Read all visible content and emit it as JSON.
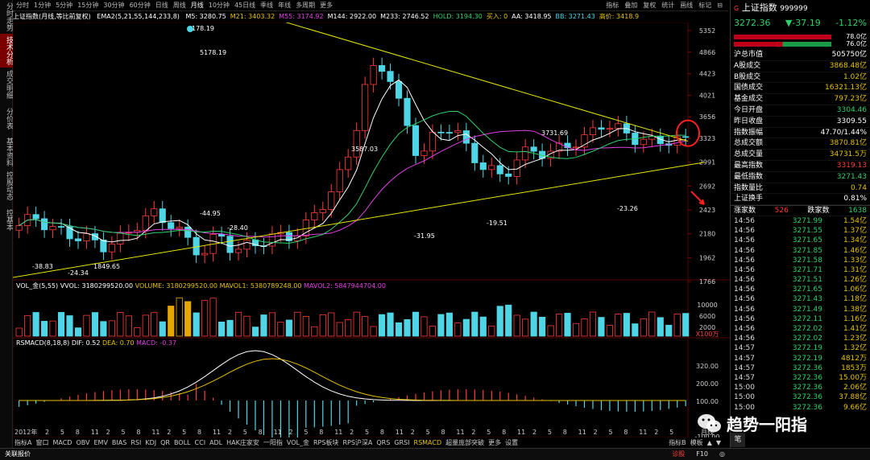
{
  "left_sidebar": [
    "分时走势",
    "技术分析",
    "成交明细",
    "分价表",
    "基本资料",
    "控股动态",
    "控基本"
  ],
  "left_sidebar_active": 1,
  "period_tabs": [
    "分时",
    "1分钟",
    "5分钟",
    "15分钟",
    "30分钟",
    "60分钟",
    "日线",
    "周线",
    "月线",
    "10分钟",
    "45日线",
    "季线",
    "年线",
    "多周期",
    "更多"
  ],
  "period_active": 8,
  "top_tools": [
    "指标",
    "叠加",
    "复权",
    "统计",
    "画线",
    "标记",
    "⊟"
  ],
  "header": {
    "title": "上证指数(月线,等比前复权)",
    "ema_label": "EMA2(5,21,55,144,233,8)",
    "items": [
      {
        "text": "M5: 3280.75",
        "color": "#ffffff"
      },
      {
        "text": "M21: 3403.32",
        "color": "#e6c200"
      },
      {
        "text": "M55: 3174.92",
        "color": "#e040e0"
      },
      {
        "text": "M144: 2922.00",
        "color": "#ffffff"
      },
      {
        "text": "M233: 2746.52",
        "color": "#ffffff"
      },
      {
        "text": "HOLD: 3194.30",
        "color": "#2ed16b"
      },
      {
        "text": "买入: 0",
        "color": "#e6c200"
      },
      {
        "text": "AA: 3418.95",
        "color": "#ffffff"
      },
      {
        "text": "BB: 3271.43",
        "color": "#4fd6e6"
      },
      {
        "text": "高价: 3418.9",
        "color": "#e6c200"
      }
    ]
  },
  "price_axis": [
    "5352",
    "4866",
    "4423",
    "4021",
    "3656",
    "3323",
    "2991",
    "2692",
    "2423",
    "2180",
    "1962",
    "1766"
  ],
  "price_annotations": [
    {
      "text": "5178.19",
      "color": "#ffffff"
    },
    {
      "text": "178.19",
      "color": "#ffffff"
    },
    {
      "text": "3587.03",
      "color": "#ffffff"
    },
    {
      "text": "3731.69",
      "color": "#ffffff"
    },
    {
      "text": "-44.95",
      "color": "#ffffff"
    },
    {
      "text": "-28.40",
      "color": "#ffffff"
    },
    {
      "text": "-31.95",
      "color": "#ffffff"
    },
    {
      "text": "-19.51",
      "color": "#ffffff"
    },
    {
      "text": "-23.26",
      "color": "#ffffff"
    },
    {
      "text": "-38.83",
      "color": "#ffffff"
    },
    {
      "text": "-24.34",
      "color": "#ffffff"
    },
    {
      "text": "1849.65",
      "color": "#ffffff"
    }
  ],
  "volume_panel": {
    "label": "VOL_金(5,55)",
    "vvol": "VVOL: 3180299520.00",
    "volume": "VOLUME: 3180299520.00",
    "mavol1": "MAVOL1: 5380789248.00",
    "mavol2": "MAVOL2: 5847944704.00",
    "axis": [
      "10000",
      "6000",
      "2000"
    ],
    "unit": "X100万"
  },
  "macd_panel": {
    "label": "RSMACD(8,18,8)",
    "dif": "DIF: 0.52",
    "dea": "DEA: 0.70",
    "macd": "MACD: -0.37",
    "axis": [
      "320.00",
      "200.00",
      "100.00",
      "0.00",
      "-100.00"
    ]
  },
  "x_axis": {
    "year": "2012年",
    "labels": [
      "2",
      "5",
      "8",
      "11",
      "2",
      "5",
      "8",
      "11",
      "2",
      "5",
      "8",
      "11",
      "2",
      "5",
      "8",
      "11",
      "2",
      "5",
      "8",
      "11",
      "2",
      "5",
      "8",
      "11",
      "2",
      "5",
      "8",
      "11",
      "2",
      "5",
      "8",
      "11",
      "2",
      "5",
      "8",
      "11",
      "2",
      "5",
      "8",
      "11",
      "2",
      "5"
    ],
    "right_label": "月线"
  },
  "bottom_tabs": [
    "指标A",
    "窗口",
    "MACD",
    "OBV",
    "EMV",
    "BIAS",
    "RSI",
    "KDJ",
    "QR",
    "BOLL",
    "CCI",
    "ADL",
    "HAK庄家安",
    "一阳指",
    "VOL_金",
    "RPS板块",
    "RPS沪深A",
    "QRS",
    "GRSI",
    "RSMACD",
    "超量庞部突破",
    "更多",
    "设置"
  ],
  "bottom_active": "RSMACD",
  "bottom_right": [
    "指标B",
    "模板",
    "▲",
    "▼"
  ],
  "status": {
    "left": "关联报价",
    "right_items": [
      "诊股",
      "F10",
      "◎"
    ]
  },
  "quote": {
    "name": "上证指数",
    "code": "999999",
    "price": "3272.36",
    "change": "▼-37.19",
    "pct": "-1.12%",
    "bar1": "78.0亿",
    "bar2": "76.0亿",
    "rows": [
      {
        "k": "沪总市值",
        "v": "505750亿",
        "c": "#ffffff"
      },
      {
        "k": "A股成交",
        "v": "3868.48亿",
        "c": "#e6c200"
      },
      {
        "k": "B股成交",
        "v": "1.02亿",
        "c": "#e6c200"
      },
      {
        "k": "国债成交",
        "v": "16321.13亿",
        "c": "#e6c200"
      },
      {
        "k": "基金成交",
        "v": "797.23亿",
        "c": "#e6c200"
      },
      {
        "k": "今日开盘",
        "v": "3304.46",
        "c": "#2ed16b"
      },
      {
        "k": "昨日收盘",
        "v": "3309.55",
        "c": "#ffffff"
      },
      {
        "k": "指数振幅",
        "v": "47.70/1.44%",
        "c": "#ffffff"
      },
      {
        "k": "总成交额",
        "v": "3870.81亿",
        "c": "#e6c200"
      },
      {
        "k": "总成交量",
        "v": "34731.5万",
        "c": "#e6c200"
      },
      {
        "k": "最高指数",
        "v": "3319.13",
        "c": "#ff3b3b"
      },
      {
        "k": "最低指数",
        "v": "3271.43",
        "c": "#2ed16b"
      },
      {
        "k": "指数量比",
        "v": "0.74",
        "c": "#e6c200"
      },
      {
        "k": "上证换手",
        "v": "0.81%",
        "c": "#ffffff"
      }
    ],
    "up_label": "涨家数",
    "up_count": "526",
    "down_label": "跌家数",
    "down_count": "1638",
    "ticks": [
      {
        "t": "14:56",
        "p": "3271.99",
        "c": "1.54亿"
      },
      {
        "t": "14:56",
        "p": "3271.55",
        "c": "1.37亿"
      },
      {
        "t": "14:56",
        "p": "3271.65",
        "c": "1.34亿"
      },
      {
        "t": "14:56",
        "p": "3271.85",
        "c": "1.46亿"
      },
      {
        "t": "14:56",
        "p": "3271.58",
        "c": "1.33亿"
      },
      {
        "t": "14:56",
        "p": "3271.71",
        "c": "1.31亿"
      },
      {
        "t": "14:56",
        "p": "3271.51",
        "c": "1.26亿"
      },
      {
        "t": "14:56",
        "p": "3271.65",
        "c": "1.06亿"
      },
      {
        "t": "14:56",
        "p": "3271.43",
        "c": "1.18亿"
      },
      {
        "t": "14:56",
        "p": "3271.49",
        "c": "1.38亿"
      },
      {
        "t": "14:56",
        "p": "3272.11",
        "c": "1.16亿"
      },
      {
        "t": "14:56",
        "p": "3272.02",
        "c": "1.41亿"
      },
      {
        "t": "14:56",
        "p": "3272.02",
        "c": "1.23亿"
      },
      {
        "t": "14:57",
        "p": "3272.19",
        "c": "1.32亿"
      },
      {
        "t": "14:57",
        "p": "3272.19",
        "c": "4812万"
      },
      {
        "t": "14:57",
        "p": "3272.36",
        "c": "1853万"
      },
      {
        "t": "14:57",
        "p": "3272.36",
        "c": "15.00万"
      },
      {
        "t": "15:00",
        "p": "3272.36",
        "c": "2.06亿"
      },
      {
        "t": "15:00",
        "p": "3272.36",
        "c": "37.88亿"
      },
      {
        "t": "15:00",
        "p": "3272.36",
        "c": "9.66亿"
      }
    ],
    "tab": "笔",
    "watermark": "趋势一阳指"
  },
  "chart_data": {
    "type": "candlestick",
    "period": "monthly",
    "title": "上证指数(月线,等比前复权)",
    "ylim": [
      1766,
      5352
    ],
    "highlights": {
      "high": 5178.19,
      "low": 1849.65
    },
    "trendline_upper": [
      [
        0,
        5178
      ],
      [
        40,
        3330
      ]
    ],
    "trendline_lower": [
      [
        0,
        2000
      ],
      [
        40,
        2990
      ]
    ],
    "closes": [
      2260,
      2350,
      2220,
      2180,
      2130,
      2070,
      2110,
      2270,
      2380,
      2300,
      2130,
      1990,
      2180,
      2010,
      2090,
      2130,
      2160,
      2200,
      2450,
      2680,
      3230,
      4440,
      4610,
      3660,
      3050,
      3380,
      3540,
      3100,
      2930,
      2780,
      3080,
      3150,
      3110,
      3250,
      3310,
      3570,
      3440,
      3330,
      3260,
      3310,
      3270
    ]
  }
}
